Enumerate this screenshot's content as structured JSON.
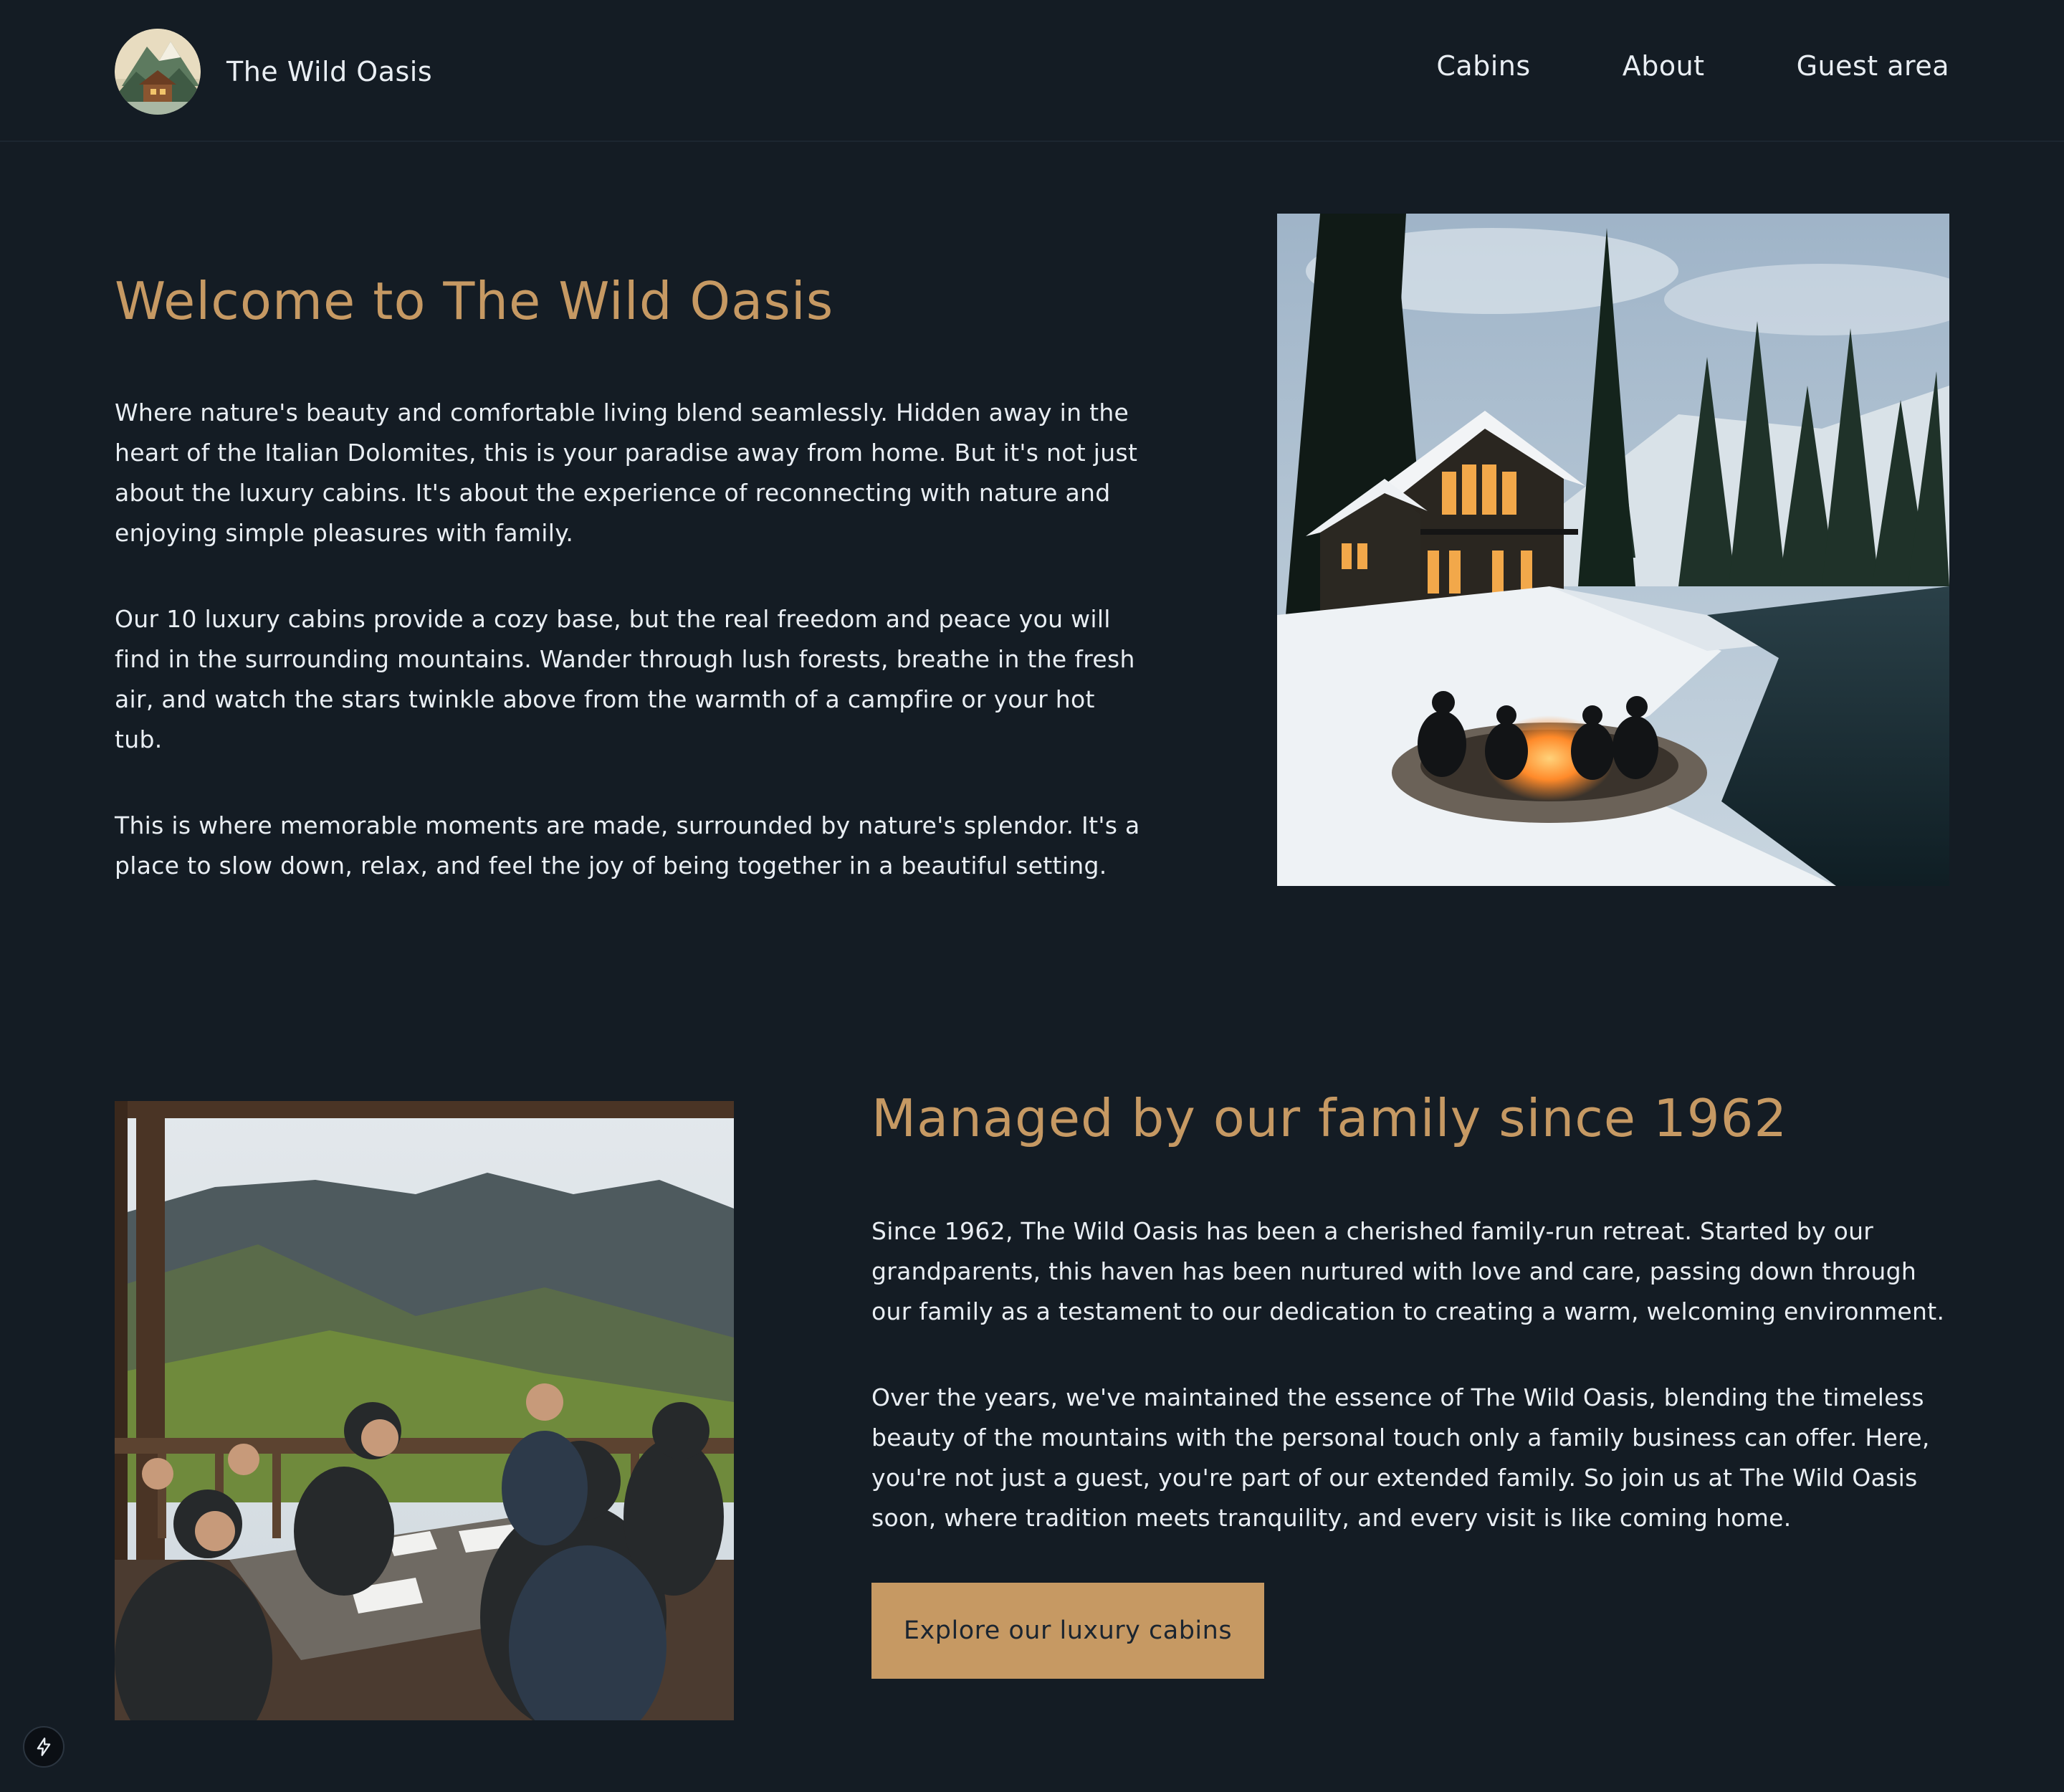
{
  "header": {
    "brand": "The Wild Oasis",
    "nav": [
      "Cabins",
      "About",
      "Guest area"
    ]
  },
  "welcome": {
    "title": "Welcome to The Wild Oasis",
    "paragraphs": [
      "Where nature's beauty and comfortable living blend seamlessly. Hidden away in the heart of the Italian Dolomites, this is your paradise away from home. But it's not just about the luxury cabins. It's about the experience of reconnecting with nature and enjoying simple pleasures with family.",
      "Our 10 luxury cabins provide a cozy base, but the real freedom and peace you will find in the surrounding mountains. Wander through lush forests, breathe in the fresh air, and watch the stars twinkle above from the warmth of a campfire or your hot tub.",
      "This is where memorable moments are made, surrounded by nature's splendor. It's a place to slow down, relax, and feel the joy of being together in a beautiful setting."
    ]
  },
  "family": {
    "title": "Managed by our family since 1962",
    "paragraphs": [
      "Since 1962, The Wild Oasis has been a cherished family-run retreat. Started by our grandparents, this haven has been nurtured with love and care, passing down through our family as a testament to our dedication to creating a warm, welcoming environment.",
      "Over the years, we've maintained the essence of The Wild Oasis, blending the timeless beauty of the mountains with the personal touch only a family business can offer. Here, you're not just a guest, you're part of our extended family. So join us at The Wild Oasis soon, where tradition meets tranquility, and every visit is like coming home."
    ],
    "cta": "Explore our luxury cabins"
  },
  "colors": {
    "background": "#141c24",
    "accent": "#c69963",
    "text": "#e9eef3"
  },
  "icons": {
    "logo": "mountain-cabin-logo",
    "dev": "lightning-bolt-icon"
  }
}
